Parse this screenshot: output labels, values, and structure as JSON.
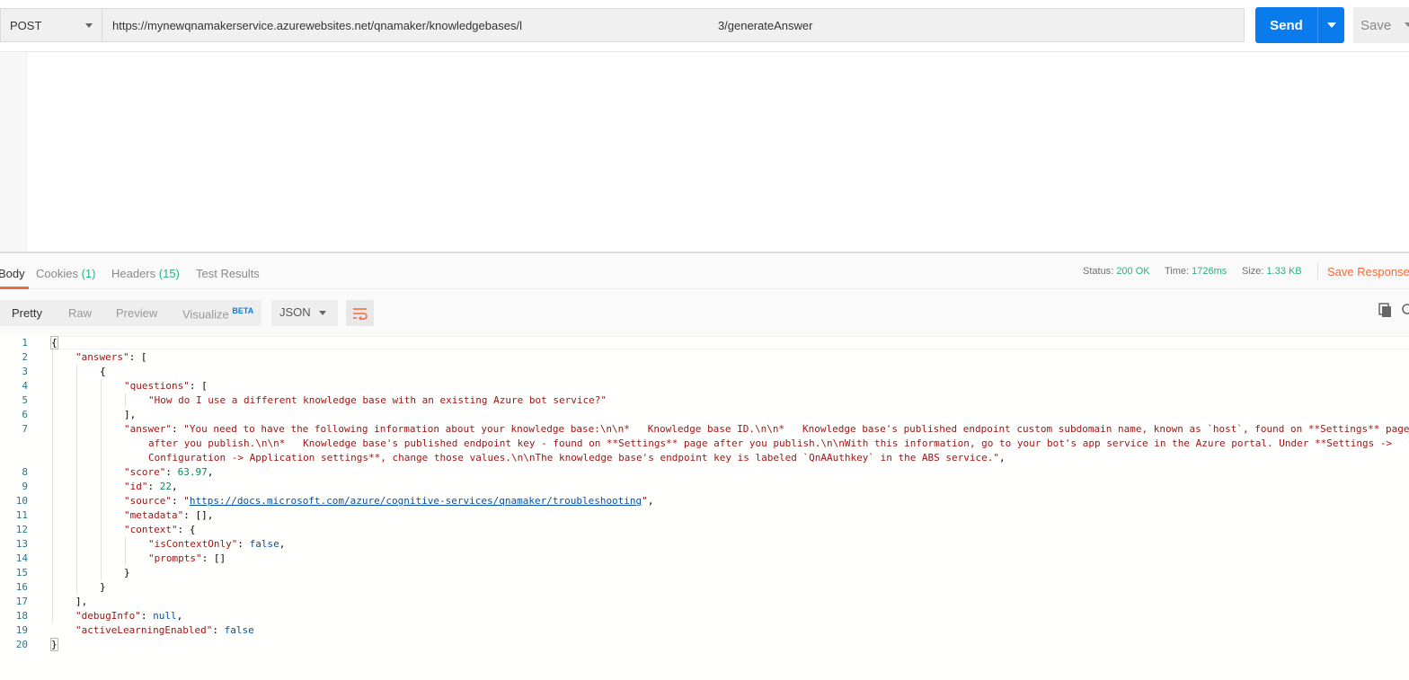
{
  "request": {
    "method": "POST",
    "url_start": "https://mynewqnamakerservice.azurewebsites.net/qnamaker/knowledgebases/l",
    "url_end": "3/generateAnswer",
    "send_label": "Send",
    "save_label": "Save"
  },
  "response_tabs": {
    "body": "Body",
    "cookies": "Cookies",
    "cookies_count": "(1)",
    "headers": "Headers",
    "headers_count": "(15)",
    "tests": "Test Results"
  },
  "status": {
    "status_label": "Status:",
    "status_value": "200 OK",
    "time_label": "Time:",
    "time_value": "1726ms",
    "size_label": "Size:",
    "size_value": "1.33 KB",
    "save_response": "Save Response"
  },
  "view": {
    "pretty": "Pretty",
    "raw": "Raw",
    "preview": "Preview",
    "visualize": "Visualize",
    "beta": "BETA",
    "format": "JSON"
  },
  "line_numbers": [
    "1",
    "2",
    "3",
    "4",
    "5",
    "6",
    "7",
    "8",
    "9",
    "10",
    "11",
    "12",
    "13",
    "14",
    "15",
    "16",
    "17",
    "18",
    "19",
    "20"
  ],
  "json": {
    "k_answers": "\"answers\"",
    "k_questions": "\"questions\"",
    "v_question": "\"How do I use a different knowledge base with an existing Azure bot service?\"",
    "k_answer": "\"answer\"",
    "v_answer_1": "\"You need to have the following information about your knowledge base:\\n\\n*   Knowledge base ID.\\n\\n*   Knowledge base's published endpoint custom subdomain name, known as `host`, found on **Settings** page",
    "v_answer_2": "after you publish.\\n\\n*   Knowledge base's published endpoint key - found on **Settings** page after you publish.\\n\\nWith this information, go to your bot's app service in the Azure portal. Under **Settings ->",
    "v_answer_3": "Configuration -> Application settings**, change those values.\\n\\nThe knowledge base's endpoint key is labeled `QnAAuthkey` in the ABS service.\"",
    "k_score": "\"score\"",
    "v_score": "63.97",
    "k_id": "\"id\"",
    "v_id": "22",
    "k_source": "\"source\"",
    "v_source": "https://docs.microsoft.com/azure/cognitive-services/qnamaker/troubleshooting",
    "k_metadata": "\"metadata\"",
    "k_context": "\"context\"",
    "k_isContextOnly": "\"isContextOnly\"",
    "v_false": "false",
    "k_prompts": "\"prompts\"",
    "k_debugInfo": "\"debugInfo\"",
    "v_null": "null",
    "k_activeLearning": "\"activeLearningEnabled\""
  },
  "colors": {
    "send": "#097bed",
    "accent": "#f26b3a",
    "status_ok": "#26b47f",
    "json_key": "#a31515",
    "json_number": "#09885a",
    "json_literal": "#0451a5",
    "line_number": "#237893"
  },
  "icons": {
    "method_dropdown": "chevron-down-icon",
    "send_dropdown": "chevron-down-icon",
    "wrap": "wrap-lines-icon",
    "copy": "copy-icon",
    "search": "search-icon"
  }
}
